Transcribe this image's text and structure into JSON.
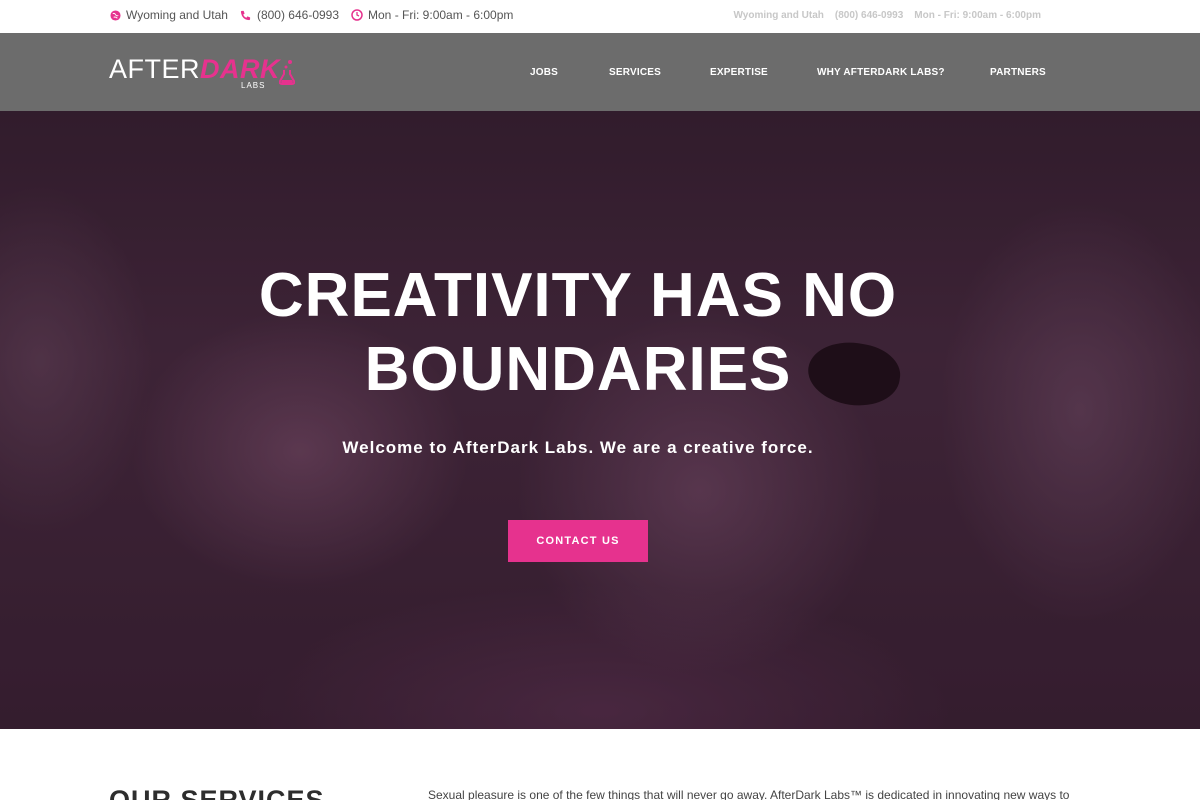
{
  "topbar": {
    "location": "Wyoming and Utah",
    "phone": "(800) 646-0993",
    "hours": "Mon - Fri: 9:00am - 6:00pm",
    "right_location": "Wyoming and Utah",
    "right_phone": "(800) 646-0993",
    "right_hours": "Mon - Fri: 9:00am - 6:00pm"
  },
  "nav": {
    "logo_after": "AFTER",
    "logo_dark": "DARK",
    "logo_labs": "LABS",
    "items": [
      "JOBS",
      "SERVICES",
      "EXPERTISE",
      "WHY AFTERDARK LABS?",
      "PARTNERS"
    ]
  },
  "hero": {
    "headline_line1": "CREATIVITY HAS NO",
    "headline_line2": "BOUNDARIES",
    "subheadline": "Welcome to AfterDark Labs. We are a creative force.",
    "cta_label": "CONTACT US"
  },
  "services": {
    "heading": "OUR SERVICES",
    "intro": "Sexual pleasure is one of the few things that will never go away. AfterDark Labs™ is dedicated in innovating new ways to"
  },
  "colors": {
    "accent": "#e6328e",
    "nav_bg": "#6c6c6c",
    "hero_tint": "#3a2535"
  },
  "icons": [
    "globe-icon",
    "phone-icon",
    "clock-icon",
    "flask-icon"
  ]
}
